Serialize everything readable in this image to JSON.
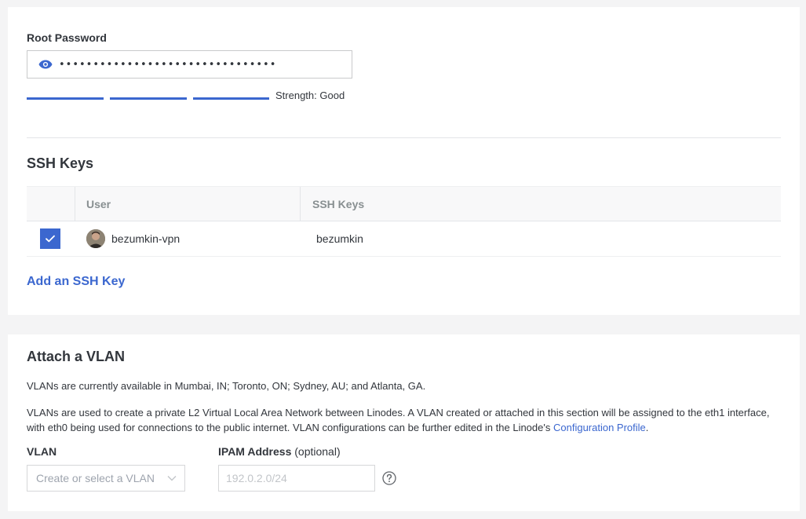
{
  "root_password": {
    "label": "Root Password",
    "value": "••••••••••••••••••••••••••••••••",
    "strength_text": "Strength: Good",
    "strength_level": 3,
    "strength_max": 3,
    "icon": "eye-icon"
  },
  "ssh": {
    "title": "SSH Keys",
    "columns": [
      "User",
      "SSH Keys"
    ],
    "rows": [
      {
        "checked": true,
        "user": "bezumkin-vpn",
        "key": "bezumkin"
      }
    ],
    "add_link": "Add an SSH Key"
  },
  "vlan": {
    "title": "Attach a VLAN",
    "availability": "VLANs are currently available in Mumbai, IN; Toronto, ON; Sydney, AU; and Atlanta, GA.",
    "description": "VLANs are used to create a private L2 Virtual Local Area Network between Linodes. A VLAN created or attached in this section will be assigned to the eth1 interface, with eth0 being used for connections to the public internet. VLAN configurations can be further edited in the Linode's",
    "description_link": "Configuration Profile",
    "description_end": ".",
    "vlan_label": "VLAN",
    "vlan_placeholder": "Create or select a VLAN",
    "ipam_label": "IPAM Address",
    "ipam_optional": "(optional)",
    "ipam_placeholder": "192.0.2.0/24"
  },
  "colors": {
    "accent": "#3b67cf",
    "text": "#32363c",
    "muted": "#888f91",
    "background": "#f4f4f5"
  }
}
